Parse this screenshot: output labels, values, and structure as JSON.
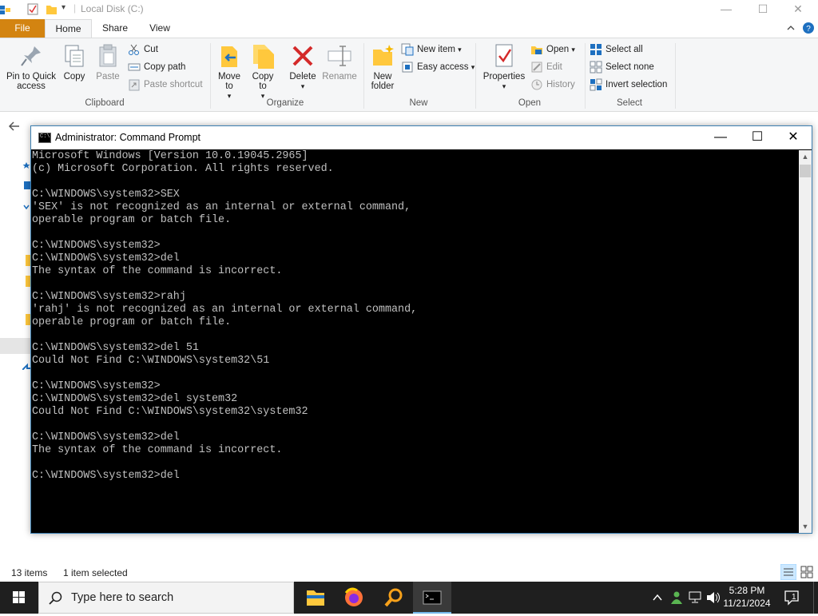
{
  "explorer": {
    "title": "Local Disk (C:)",
    "window_controls": {
      "minimize": "—",
      "maximize": "☐",
      "close": "✕"
    },
    "tabs": [
      "File",
      "Home",
      "Share",
      "View"
    ],
    "clipboard": {
      "pin_label": "Pin to Quick access",
      "copy_label": "Copy",
      "paste_label": "Paste",
      "cut_label": "Cut",
      "copy_path_label": "Copy path",
      "paste_shortcut_label": "Paste shortcut",
      "group_label": "Clipboard"
    },
    "organize": {
      "move_to_label": "Move to",
      "copy_to_label": "Copy to",
      "delete_label": "Delete",
      "rename_label": "Rename",
      "group_label": "Organize"
    },
    "new": {
      "new_folder_label": "New folder",
      "new_item_label": "New item",
      "easy_access_label": "Easy access",
      "group_label": "New"
    },
    "open": {
      "properties_label": "Properties",
      "open_label": "Open",
      "edit_label": "Edit",
      "history_label": "History",
      "group_label": "Open"
    },
    "select": {
      "select_all_label": "Select all",
      "select_none_label": "Select none",
      "invert_label": "Invert selection",
      "group_label": "Select"
    },
    "status": {
      "items": "13 items",
      "selected": "1 item selected"
    }
  },
  "cmd": {
    "title": "Administrator: Command Prompt",
    "lines": [
      "Microsoft Windows [Version 10.0.19045.2965]",
      "(c) Microsoft Corporation. All rights reserved.",
      "",
      "C:\\WINDOWS\\system32>SEX",
      "'SEX' is not recognized as an internal or external command,",
      "operable program or batch file.",
      "",
      "C:\\WINDOWS\\system32>",
      "C:\\WINDOWS\\system32>del",
      "The syntax of the command is incorrect.",
      "",
      "C:\\WINDOWS\\system32>rahj",
      "'rahj' is not recognized as an internal or external command,",
      "operable program or batch file.",
      "",
      "C:\\WINDOWS\\system32>del 51",
      "Could Not Find C:\\WINDOWS\\system32\\51",
      "",
      "C:\\WINDOWS\\system32>",
      "C:\\WINDOWS\\system32>del system32",
      "Could Not Find C:\\WINDOWS\\system32\\system32",
      "",
      "C:\\WINDOWS\\system32>del",
      "The syntax of the command is incorrect.",
      "",
      "C:\\WINDOWS\\system32>del"
    ],
    "controls": {
      "minimize": "—",
      "maximize": "☐",
      "close": "✕"
    }
  },
  "taskbar": {
    "search_placeholder": "Type here to search",
    "time": "5:28 PM",
    "date": "11/21/2024",
    "notification_count": "1"
  },
  "colors": {
    "file_tab": "#d38411",
    "console_bg": "#000000",
    "console_fg": "#c0c0c0",
    "taskbar": "#1f1f1f"
  }
}
